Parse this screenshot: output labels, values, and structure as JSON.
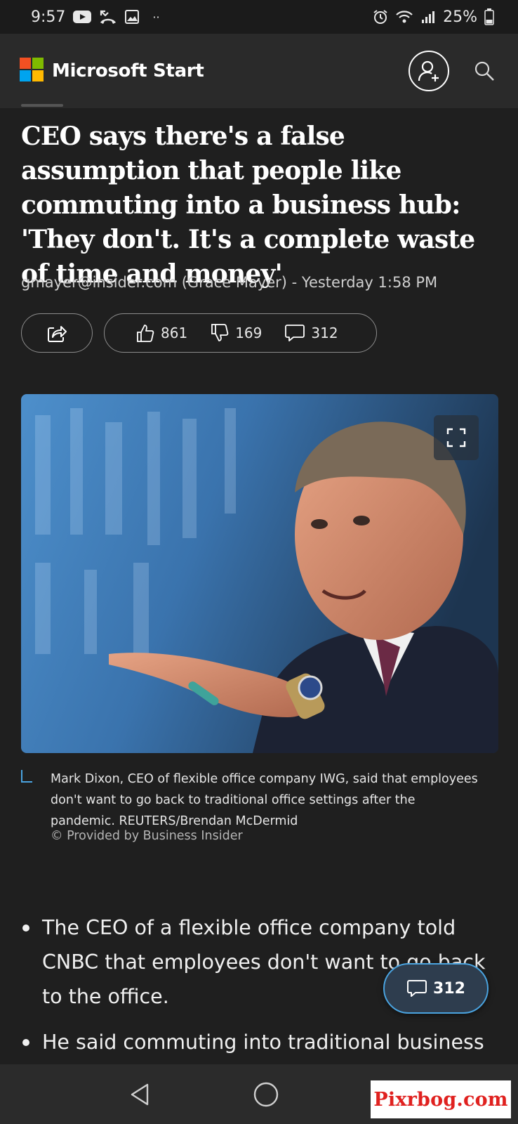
{
  "status_bar": {
    "time": "9:57",
    "notification_icons": [
      "youtube-icon",
      "missed-call-icon",
      "gallery-icon"
    ],
    "overflow": "··",
    "battery": "25%",
    "indicators": [
      "alarm-icon",
      "wifi-icon",
      "signal-icon",
      "battery-icon"
    ]
  },
  "header": {
    "brand": "Microsoft Start",
    "logo_colors": [
      "#f25022",
      "#7fba00",
      "#00a4ef",
      "#ffb900"
    ],
    "actions": [
      "add-profile-icon",
      "search-icon"
    ]
  },
  "article": {
    "headline": "CEO says there's a false assumption that people like commuting into a business hub: 'They don't. It's a complete waste of time and money'",
    "byline": "gmayer@insider.com (Grace Mayer) - Yesterday 1:58 PM",
    "reactions": {
      "likes": "861",
      "dislikes": "169",
      "comments": "312"
    },
    "image_caption": "Mark Dixon, CEO of flexible office company IWG, said that employees don't want to go back to traditional office settings after the pandemic. REUTERS/Brendan McDermid",
    "provided_by": "© Provided by Business Insider",
    "bullets": [
      "The CEO of a flexible office company told CNBC that employees don't want to go back to the office.",
      "He said commuting into traditional business"
    ]
  },
  "comment_fab": {
    "count": "312"
  },
  "nav": {
    "buttons": [
      "back-icon",
      "home-icon",
      "recents-icon"
    ]
  },
  "watermark": {
    "text": "Pixrbog.com"
  },
  "colors": {
    "accent": "#4aa3df",
    "background": "#1f1f1f",
    "header_bg": "#2a2a2a"
  }
}
